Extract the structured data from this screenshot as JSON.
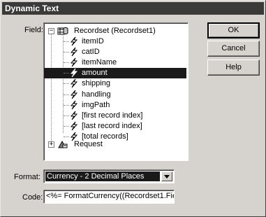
{
  "window": {
    "title": "Dynamic Text"
  },
  "labels": {
    "field": "Field:",
    "format": "Format:",
    "code": "Code:"
  },
  "tree": {
    "recordset": {
      "label": "Recordset (Recordset1)",
      "expander": "−"
    },
    "fields": [
      "itemID",
      "catID",
      "itemName",
      "amount",
      "shipping",
      "handling",
      "imgPath",
      "[first record index]",
      "[last record index]",
      "[total records]"
    ],
    "selected_index": 3,
    "request": {
      "label": "Request",
      "expander": "+"
    }
  },
  "format": {
    "value": "Currency - 2 Decimal Places"
  },
  "code": {
    "value": "<%= FormatCurrency((Recordset1.Fields.I"
  },
  "buttons": {
    "ok": "OK",
    "cancel": "Cancel",
    "help": "Help"
  },
  "icons": {
    "recordset": "recordset-icon",
    "field": "lightning-bolt-icon",
    "request": "request-icon",
    "dropdown": "chevron-down-icon"
  }
}
